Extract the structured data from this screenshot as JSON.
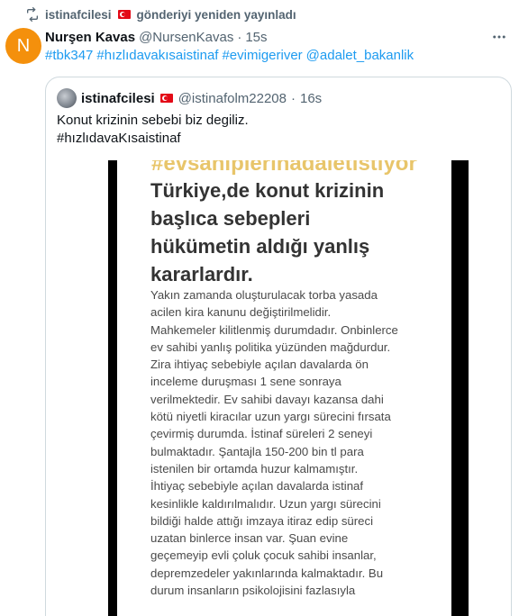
{
  "repost": {
    "username": "istinafcilesi",
    "action": "gönderiyi yeniden yayınladı"
  },
  "post": {
    "avatar_letter": "N",
    "display_name": "Nurşen Kavas",
    "handle": "@NursenKavas",
    "separator": "·",
    "time": "15s",
    "hashtags": [
      "#tbk347",
      "#hızlıdavakısaistinaf",
      "#evimigeriver",
      "@adalet_bakanlik"
    ]
  },
  "quote": {
    "display_name": "istinafcilesi",
    "handle": "@istinafolm22208",
    "separator": "·",
    "time": "16s",
    "text_lines": [
      "Konut krizinin sebebi biz degiliz.",
      "#hızlıdavaKısaistinaf"
    ],
    "image": {
      "top_text": "#evsahiplerinadaletistiyor",
      "heading_lines": [
        "Türkiye,de konut krizinin",
        "başlıca sebepleri",
        "hükümetin aldığı yanlış",
        "kararlardır."
      ],
      "body_lines": [
        "Yakın zamanda oluşturulacak torba yasada",
        "acilen kira kanunu değiştirilmelidir.",
        "Mahkemeler kilitlenmiş durumdadır. Onbinlerce",
        "ev sahibi yanlış politika yüzünden mağdurdur.",
        "Zira ihtiyaç sebebiyle açılan davalarda ön",
        "inceleme duruşması 1 sene sonraya",
        "verilmektedir. Ev sahibi davayı kazansa dahi",
        "kötü niyetli kiracılar uzun yargı sürecini fırsata",
        "çevirmiş durumda. İstinaf süreleri 2 seneyi",
        "bulmaktadır. Şantajla 150-200 bin tl para",
        "istenilen bir ortamda huzur kalmamıştır.",
        "İhtiyaç sebebiyle açılan davalarda istinaf",
        "kesinlikle kaldırılmalıdır. Uzun yargı sürecini",
        "bildiği halde attığı imzaya itiraz edip süreci",
        "uzatan binlerce insan var. Şuan evine",
        "geçemeyip evli çoluk çocuk sahibi insanlar,",
        "depremzedeler yakınlarında kalmaktadır. Bu",
        "durum insanların psikolojisini fazlasıyla"
      ]
    }
  },
  "icons": {
    "repost": "repost-icon",
    "more": "more-icon",
    "flag": "turkey-flag-icon"
  },
  "colors": {
    "link": "#1d9bf0",
    "muted": "#536471",
    "avatar": "#f4900c",
    "flag": "#e30a17"
  }
}
